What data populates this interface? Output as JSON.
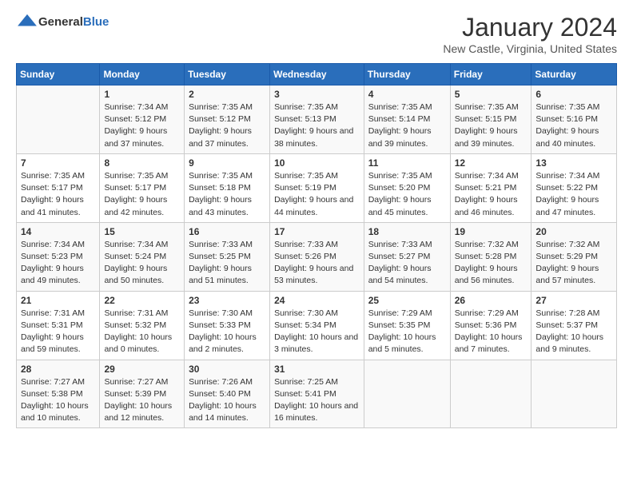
{
  "header": {
    "logo_general": "General",
    "logo_blue": "Blue",
    "title": "January 2024",
    "subtitle": "New Castle, Virginia, United States"
  },
  "days_of_week": [
    "Sunday",
    "Monday",
    "Tuesday",
    "Wednesday",
    "Thursday",
    "Friday",
    "Saturday"
  ],
  "weeks": [
    [
      {
        "num": "",
        "sunrise": "",
        "sunset": "",
        "daylight": "",
        "empty": true
      },
      {
        "num": "1",
        "sunrise": "Sunrise: 7:34 AM",
        "sunset": "Sunset: 5:12 PM",
        "daylight": "Daylight: 9 hours and 37 minutes."
      },
      {
        "num": "2",
        "sunrise": "Sunrise: 7:35 AM",
        "sunset": "Sunset: 5:12 PM",
        "daylight": "Daylight: 9 hours and 37 minutes."
      },
      {
        "num": "3",
        "sunrise": "Sunrise: 7:35 AM",
        "sunset": "Sunset: 5:13 PM",
        "daylight": "Daylight: 9 hours and 38 minutes."
      },
      {
        "num": "4",
        "sunrise": "Sunrise: 7:35 AM",
        "sunset": "Sunset: 5:14 PM",
        "daylight": "Daylight: 9 hours and 39 minutes."
      },
      {
        "num": "5",
        "sunrise": "Sunrise: 7:35 AM",
        "sunset": "Sunset: 5:15 PM",
        "daylight": "Daylight: 9 hours and 39 minutes."
      },
      {
        "num": "6",
        "sunrise": "Sunrise: 7:35 AM",
        "sunset": "Sunset: 5:16 PM",
        "daylight": "Daylight: 9 hours and 40 minutes."
      }
    ],
    [
      {
        "num": "7",
        "sunrise": "Sunrise: 7:35 AM",
        "sunset": "Sunset: 5:17 PM",
        "daylight": "Daylight: 9 hours and 41 minutes."
      },
      {
        "num": "8",
        "sunrise": "Sunrise: 7:35 AM",
        "sunset": "Sunset: 5:17 PM",
        "daylight": "Daylight: 9 hours and 42 minutes."
      },
      {
        "num": "9",
        "sunrise": "Sunrise: 7:35 AM",
        "sunset": "Sunset: 5:18 PM",
        "daylight": "Daylight: 9 hours and 43 minutes."
      },
      {
        "num": "10",
        "sunrise": "Sunrise: 7:35 AM",
        "sunset": "Sunset: 5:19 PM",
        "daylight": "Daylight: 9 hours and 44 minutes."
      },
      {
        "num": "11",
        "sunrise": "Sunrise: 7:35 AM",
        "sunset": "Sunset: 5:20 PM",
        "daylight": "Daylight: 9 hours and 45 minutes."
      },
      {
        "num": "12",
        "sunrise": "Sunrise: 7:34 AM",
        "sunset": "Sunset: 5:21 PM",
        "daylight": "Daylight: 9 hours and 46 minutes."
      },
      {
        "num": "13",
        "sunrise": "Sunrise: 7:34 AM",
        "sunset": "Sunset: 5:22 PM",
        "daylight": "Daylight: 9 hours and 47 minutes."
      }
    ],
    [
      {
        "num": "14",
        "sunrise": "Sunrise: 7:34 AM",
        "sunset": "Sunset: 5:23 PM",
        "daylight": "Daylight: 9 hours and 49 minutes."
      },
      {
        "num": "15",
        "sunrise": "Sunrise: 7:34 AM",
        "sunset": "Sunset: 5:24 PM",
        "daylight": "Daylight: 9 hours and 50 minutes."
      },
      {
        "num": "16",
        "sunrise": "Sunrise: 7:33 AM",
        "sunset": "Sunset: 5:25 PM",
        "daylight": "Daylight: 9 hours and 51 minutes."
      },
      {
        "num": "17",
        "sunrise": "Sunrise: 7:33 AM",
        "sunset": "Sunset: 5:26 PM",
        "daylight": "Daylight: 9 hours and 53 minutes."
      },
      {
        "num": "18",
        "sunrise": "Sunrise: 7:33 AM",
        "sunset": "Sunset: 5:27 PM",
        "daylight": "Daylight: 9 hours and 54 minutes."
      },
      {
        "num": "19",
        "sunrise": "Sunrise: 7:32 AM",
        "sunset": "Sunset: 5:28 PM",
        "daylight": "Daylight: 9 hours and 56 minutes."
      },
      {
        "num": "20",
        "sunrise": "Sunrise: 7:32 AM",
        "sunset": "Sunset: 5:29 PM",
        "daylight": "Daylight: 9 hours and 57 minutes."
      }
    ],
    [
      {
        "num": "21",
        "sunrise": "Sunrise: 7:31 AM",
        "sunset": "Sunset: 5:31 PM",
        "daylight": "Daylight: 9 hours and 59 minutes."
      },
      {
        "num": "22",
        "sunrise": "Sunrise: 7:31 AM",
        "sunset": "Sunset: 5:32 PM",
        "daylight": "Daylight: 10 hours and 0 minutes."
      },
      {
        "num": "23",
        "sunrise": "Sunrise: 7:30 AM",
        "sunset": "Sunset: 5:33 PM",
        "daylight": "Daylight: 10 hours and 2 minutes."
      },
      {
        "num": "24",
        "sunrise": "Sunrise: 7:30 AM",
        "sunset": "Sunset: 5:34 PM",
        "daylight": "Daylight: 10 hours and 3 minutes."
      },
      {
        "num": "25",
        "sunrise": "Sunrise: 7:29 AM",
        "sunset": "Sunset: 5:35 PM",
        "daylight": "Daylight: 10 hours and 5 minutes."
      },
      {
        "num": "26",
        "sunrise": "Sunrise: 7:29 AM",
        "sunset": "Sunset: 5:36 PM",
        "daylight": "Daylight: 10 hours and 7 minutes."
      },
      {
        "num": "27",
        "sunrise": "Sunrise: 7:28 AM",
        "sunset": "Sunset: 5:37 PM",
        "daylight": "Daylight: 10 hours and 9 minutes."
      }
    ],
    [
      {
        "num": "28",
        "sunrise": "Sunrise: 7:27 AM",
        "sunset": "Sunset: 5:38 PM",
        "daylight": "Daylight: 10 hours and 10 minutes."
      },
      {
        "num": "29",
        "sunrise": "Sunrise: 7:27 AM",
        "sunset": "Sunset: 5:39 PM",
        "daylight": "Daylight: 10 hours and 12 minutes."
      },
      {
        "num": "30",
        "sunrise": "Sunrise: 7:26 AM",
        "sunset": "Sunset: 5:40 PM",
        "daylight": "Daylight: 10 hours and 14 minutes."
      },
      {
        "num": "31",
        "sunrise": "Sunrise: 7:25 AM",
        "sunset": "Sunset: 5:41 PM",
        "daylight": "Daylight: 10 hours and 16 minutes."
      },
      {
        "num": "",
        "sunrise": "",
        "sunset": "",
        "daylight": "",
        "empty": true
      },
      {
        "num": "",
        "sunrise": "",
        "sunset": "",
        "daylight": "",
        "empty": true
      },
      {
        "num": "",
        "sunrise": "",
        "sunset": "",
        "daylight": "",
        "empty": true
      }
    ]
  ]
}
